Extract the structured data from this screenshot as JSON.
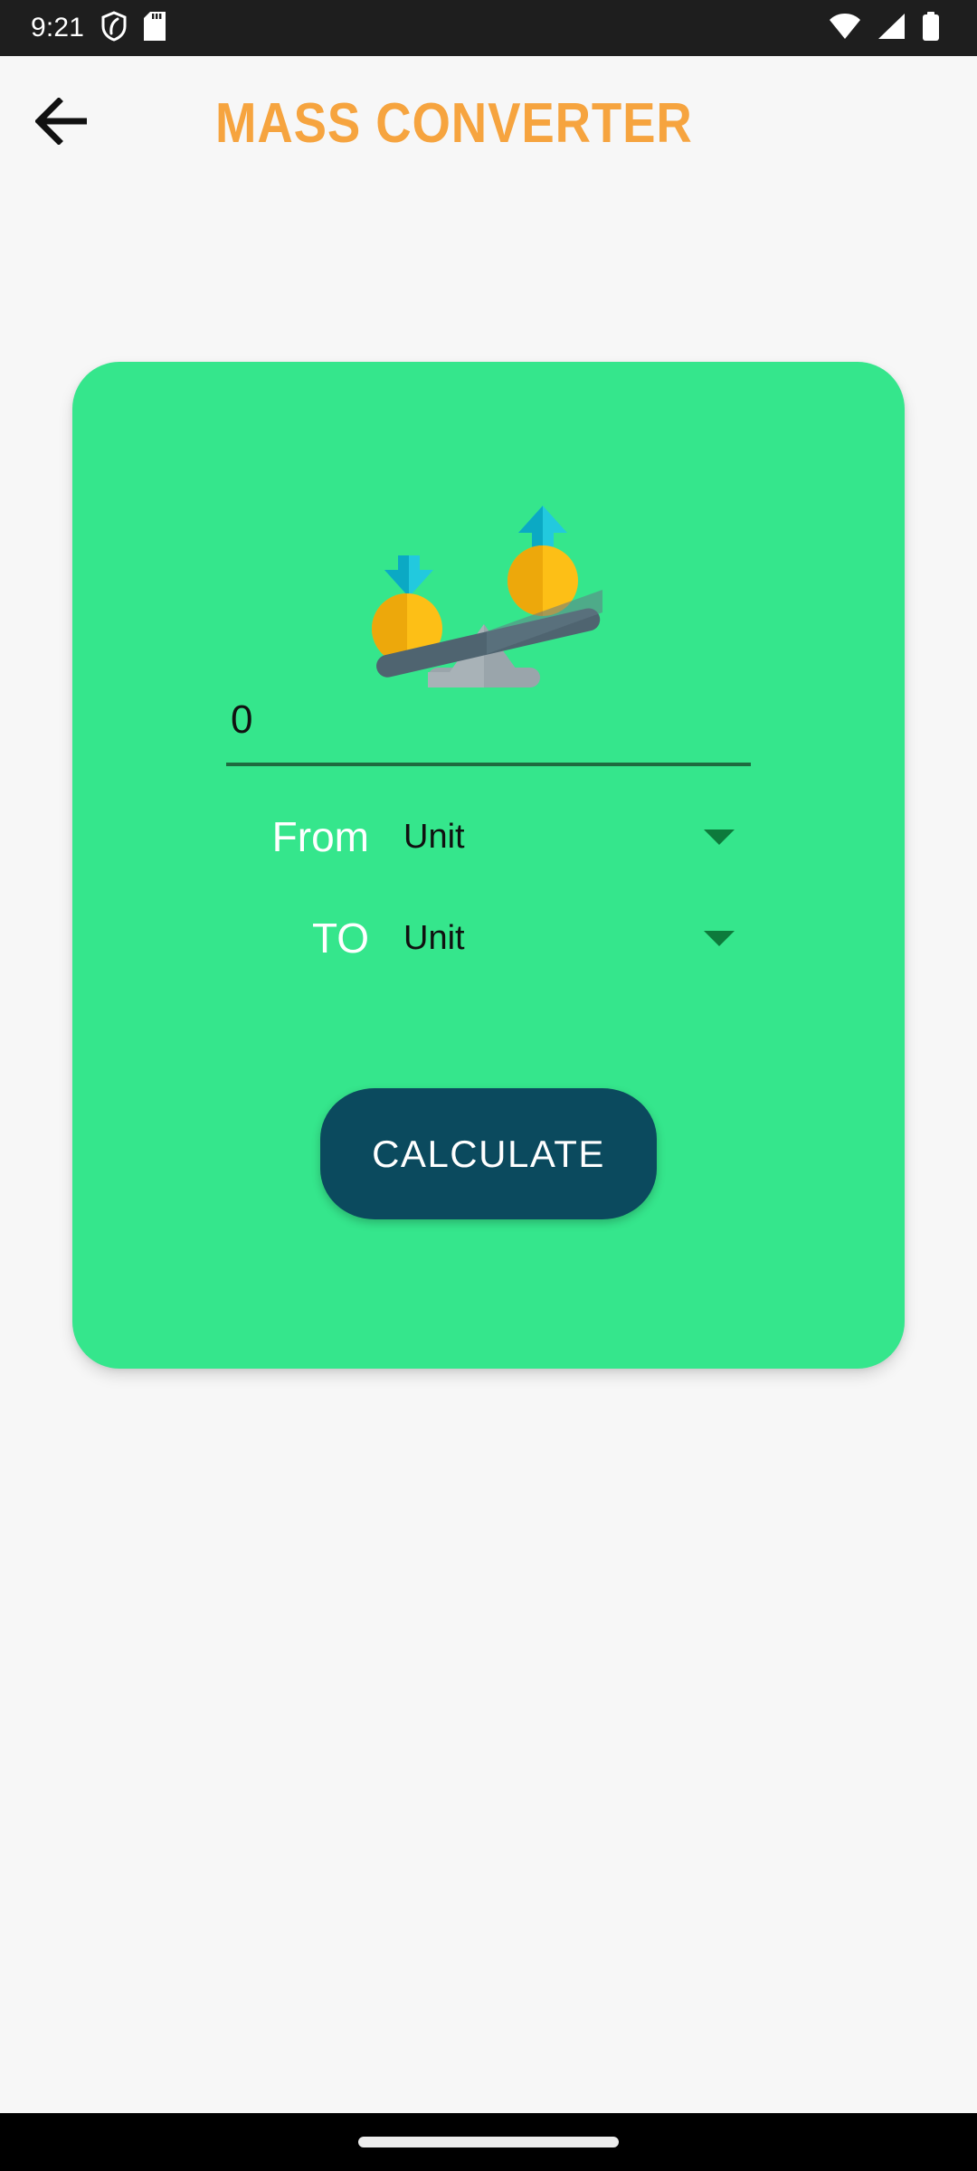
{
  "status_bar": {
    "time": "9:21",
    "left_icons": [
      "shield-icon",
      "sd-card-icon"
    ],
    "right_icons": [
      "wifi-icon",
      "cellular-signal-icon",
      "battery-icon"
    ],
    "background_color": "#1e1e1e"
  },
  "app_bar": {
    "back_icon": "back-arrow-icon",
    "title": "MASS CONVERTER",
    "title_color": "#f6a43f"
  },
  "card": {
    "background_color": "#35e68c",
    "illustration": {
      "name": "balance-scale-illustration",
      "beam_color": "#4f6470",
      "beam_color_light": "#9aa5ab",
      "base_color": "#9aa5ab",
      "ball_color_dark": "#eda80b",
      "ball_color_light": "#fdbf16",
      "arrow_color_dark": "#0ba9c4",
      "arrow_color_light": "#22c9de"
    },
    "amount_input": {
      "value": "0",
      "placeholder": "0",
      "underline_color": "#1e6b3f"
    },
    "from_row": {
      "label": "From",
      "unit_value": "Unit",
      "caret_icon": "chevron-down-icon",
      "caret_color": "#0d7a3b"
    },
    "to_row": {
      "label": "TO",
      "unit_value": "Unit",
      "caret_icon": "chevron-down-icon",
      "caret_color": "#0d7a3b"
    },
    "calculate_button": {
      "label": "CALCULATE",
      "background_color": "#0b4a5e",
      "text_color": "#ffffff"
    }
  },
  "nav_bar": {
    "gesture_pill": "home-gesture-pill",
    "background_color": "#000000"
  }
}
